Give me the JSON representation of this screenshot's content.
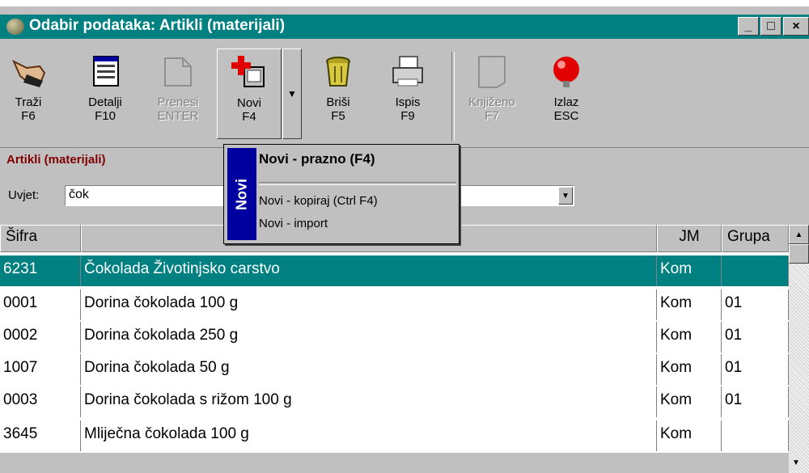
{
  "window": {
    "title": "Odabir podataka: Artikli (materijali)",
    "buttons": {
      "minimize": "_",
      "maximize": "□",
      "close": "×"
    }
  },
  "toolbar": {
    "search": {
      "label": "Traži",
      "key": "F6",
      "icon": "pointing-hand-icon"
    },
    "details": {
      "label": "Detalji",
      "key": "F10",
      "icon": "form-window-icon"
    },
    "transfer": {
      "label": "Prenesi",
      "key": "ENTER",
      "icon": "pages-icon",
      "enabled": false
    },
    "new": {
      "label": "Novi",
      "key": "F4",
      "icon": "new-red-cross-icon"
    },
    "new_dropdown": "▼",
    "delete": {
      "label": "Briši",
      "key": "F5",
      "icon": "trash-can-icon"
    },
    "print": {
      "label": "Ispis",
      "key": "F9",
      "icon": "printer-icon"
    },
    "booked": {
      "label": "Knjiženo",
      "key": "F7",
      "icon": "document-icon",
      "enabled": false
    },
    "exit": {
      "label": "Izlaz",
      "key": "ESC",
      "icon": "red-ball-icon"
    }
  },
  "section_label": "Artikli (materijali)",
  "condition": {
    "label": "Uvjet:",
    "value": "čok",
    "dropdown": "▼"
  },
  "new_menu": {
    "side_label": "Novi",
    "items": [
      {
        "label": "Novi - prazno (F4)"
      },
      {
        "label": "Novi - kopiraj (Ctrl F4)"
      },
      {
        "label": "Novi - import"
      }
    ]
  },
  "grid": {
    "columns": [
      "Šifra",
      "",
      "JM",
      "Grupa"
    ],
    "rows": [
      {
        "code": "6231",
        "name": "Čokolada Životinjsko carstvo",
        "unit": "Kom",
        "group": ""
      },
      {
        "code": "0001",
        "name": "Dorina čokolada 100 g",
        "unit": "Kom",
        "group": "01"
      },
      {
        "code": "0002",
        "name": "Dorina čokolada 250 g",
        "unit": "Kom",
        "group": "01"
      },
      {
        "code": "1007",
        "name": "Dorina čokolada 50 g",
        "unit": "Kom",
        "group": "01"
      },
      {
        "code": "0003",
        "name": "Dorina čokolada s rižom 100 g",
        "unit": "Kom",
        "group": "01"
      },
      {
        "code": "3645",
        "name": "Mliječna čokolada 100 g",
        "unit": "Kom",
        "group": ""
      }
    ],
    "selected_row": 0
  },
  "colors": {
    "title_bar": "#008080",
    "selection": "#008080",
    "section_label": "#800000",
    "menu_side": "#0000a0"
  }
}
